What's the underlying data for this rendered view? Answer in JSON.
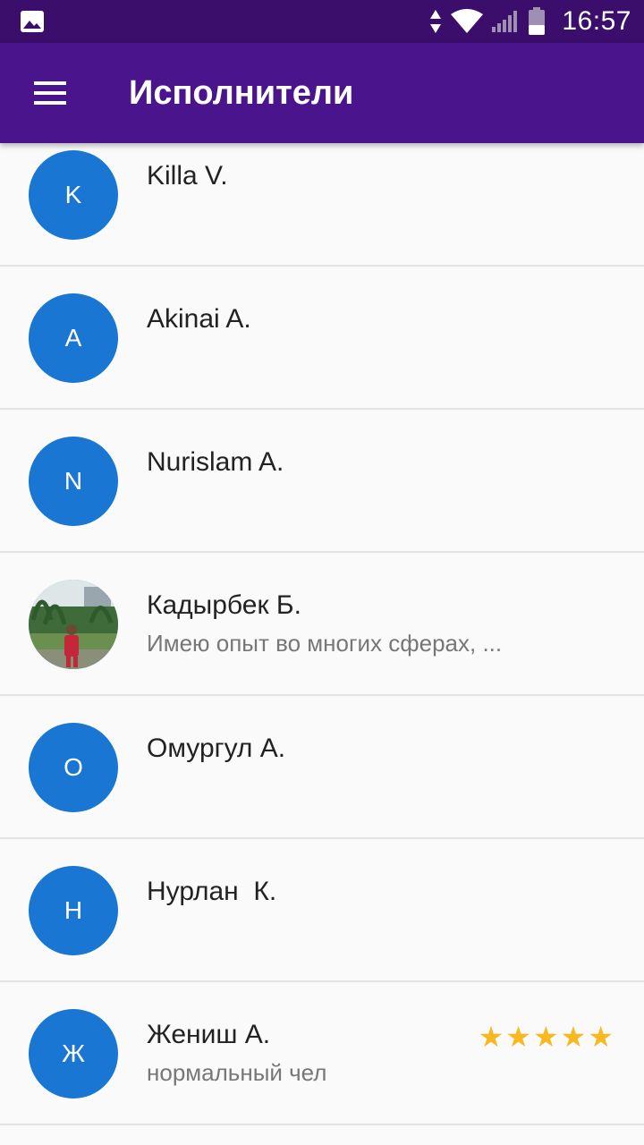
{
  "status_bar": {
    "time": "16:57",
    "icons": [
      "image-icon",
      "data-arrows-icon",
      "wifi-icon",
      "signal-icon",
      "battery-icon"
    ]
  },
  "app_bar": {
    "menu_icon": "menu-icon",
    "title": "Исполнители"
  },
  "colors": {
    "status_bar": "#3b0e6b",
    "app_bar": "#4a148c",
    "avatar": "#1976d2",
    "star": "#f7b820"
  },
  "performers": [
    {
      "initial": "K",
      "name": "Killa V.",
      "description": ""
    },
    {
      "initial": "A",
      "name": "Akinai A.",
      "description": ""
    },
    {
      "initial": "N",
      "name": "Nurislam A.",
      "description": ""
    },
    {
      "initial": "",
      "name": "Кадырбек Б.",
      "description": "Имею опыт во многих сферах, ...",
      "has_photo": true
    },
    {
      "initial": "О",
      "name": "Омургул А.",
      "description": ""
    },
    {
      "initial": "Н",
      "name": "Нурлан  К.",
      "description": ""
    },
    {
      "initial": "Ж",
      "name": "Жениш А.",
      "description": "нормальный чел",
      "rating": 5
    }
  ]
}
